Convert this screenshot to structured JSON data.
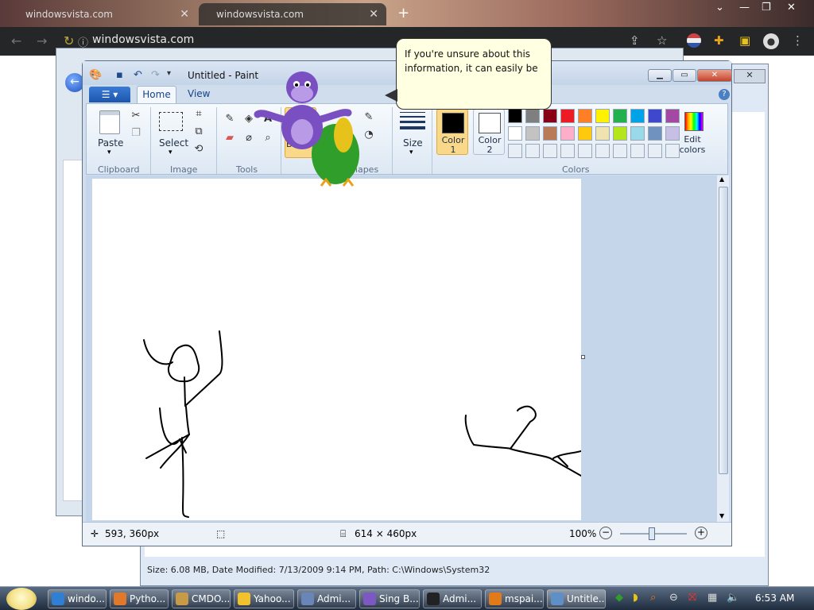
{
  "browser": {
    "tabs": [
      {
        "label": "windowsvista.com"
      },
      {
        "label": "windowsvista.com"
      }
    ],
    "new_tab": "+",
    "url": "windowsvista.com",
    "window_controls": {
      "minimize": "—",
      "restore": "❐",
      "close": "✕"
    }
  },
  "background_window": {
    "status": "Size: 6.08 MB, Date Modified: 7/13/2009 9:14 PM, Path: C:\\Windows\\System32"
  },
  "paint": {
    "title": "Untitled - Paint",
    "tabs": {
      "home": "Home",
      "view": "View"
    },
    "groups": {
      "clipboard": "Clipboard",
      "image": "Image",
      "tools": "Tools",
      "shapes": "Shapes",
      "colors": "Colors"
    },
    "buttons": {
      "paste": "Paste",
      "select": "Select",
      "brushes": "Brushes",
      "size": "Size",
      "color1": "Color",
      "color1_num": "1",
      "color2": "Color",
      "color2_num": "2",
      "edit": "Edit",
      "colors": "colors"
    },
    "color1_value": "#000000",
    "color2_value": "#ffffff",
    "palette": [
      "#000000",
      "#7f7f7f",
      "#880015",
      "#ed1c24",
      "#ff7f27",
      "#fff200",
      "#22b14c",
      "#00a2e8",
      "#3f48cc",
      "#a349a4",
      "#ffffff",
      "#c3c3c3",
      "#b97a57",
      "#ffaec9",
      "#ffc90e",
      "#efe4b0",
      "#b5e61d",
      "#99d9ea",
      "#7092be",
      "#c8bfe7"
    ],
    "status": {
      "cursor": "593, 360px",
      "size": "614 × 460px",
      "zoom": "100%"
    }
  },
  "bonzi_bubble": "If you're unsure about this information, it can easily be",
  "taskbar": {
    "items": [
      {
        "label": "windo...",
        "color": "#2f7fd4",
        "icon": "chrome-icon"
      },
      {
        "label": "Pytho...",
        "color": "#e07a2a",
        "icon": "firefox-icon"
      },
      {
        "label": "CMDO...",
        "color": "#c79a48",
        "icon": "folder-icon"
      },
      {
        "label": "Yahoo...",
        "color": "#f2c12e",
        "icon": "yahoo-icon"
      },
      {
        "label": "Admi...",
        "color": "#6a86b8",
        "icon": "admin-icon"
      },
      {
        "label": "Sing B...",
        "color": "#7b58c2",
        "icon": "bonzi-icon"
      },
      {
        "label": "Admi...",
        "color": "#222222",
        "icon": "cmd-icon"
      },
      {
        "label": "mspai...",
        "color": "#e07a1a",
        "icon": "search-icon"
      },
      {
        "label": "Untitle...",
        "color": "#5f8fc7",
        "icon": "paint-icon"
      }
    ],
    "clock": "6:53 AM"
  }
}
